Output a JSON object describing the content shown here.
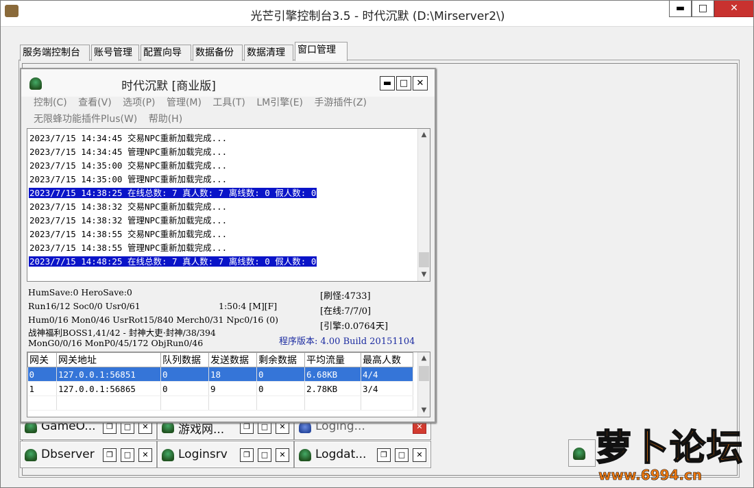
{
  "window": {
    "title": "光芒引擎控制台3.5 - 时代沉默 (D:\\Mirserver2\\)",
    "min": "▬",
    "max": "□",
    "close": "✕"
  },
  "tabs": [
    {
      "label": "服务端控制台",
      "active": false
    },
    {
      "label": "账号管理",
      "active": false
    },
    {
      "label": "配置向导",
      "active": false
    },
    {
      "label": "数据备份",
      "active": false
    },
    {
      "label": "数据清理",
      "active": false
    },
    {
      "label": "窗口管理",
      "active": true
    }
  ],
  "child": {
    "title": "时代沉默 [商业版]",
    "min": "▬",
    "max": "□",
    "close": "✕",
    "menu_row1": [
      "控制(C)",
      "查看(V)",
      "选项(P)",
      "管理(M)",
      "工具(T)",
      "LM引擎(E)",
      "手游插件(Z)"
    ],
    "menu_row2": [
      "无限蜂功能插件Plus(W)",
      "帮助(H)"
    ],
    "log": [
      {
        "text": "2023/7/15 14:34:45 交易NPC重新加载完成...",
        "highlight": false
      },
      {
        "text": "2023/7/15 14:34:45 管理NPC重新加载完成...",
        "highlight": false
      },
      {
        "text": "2023/7/15 14:35:00 交易NPC重新加载完成...",
        "highlight": false
      },
      {
        "text": "2023/7/15 14:35:00 管理NPC重新加载完成...",
        "highlight": false
      },
      {
        "text": "2023/7/15 14:38:25 在线总数: 7 真人数: 7 离线数: 0 假人数: 0",
        "highlight": true
      },
      {
        "text": "2023/7/15 14:38:32 交易NPC重新加载完成...",
        "highlight": false
      },
      {
        "text": "2023/7/15 14:38:32 管理NPC重新加载完成...",
        "highlight": false
      },
      {
        "text": "2023/7/15 14:38:55 交易NPC重新加载完成...",
        "highlight": false
      },
      {
        "text": "2023/7/15 14:38:55 管理NPC重新加载完成...",
        "highlight": false
      },
      {
        "text": "2023/7/15 14:48:25 在线总数: 7 真人数: 7 离线数: 0 假人数: 0",
        "highlight": true
      }
    ],
    "stats": {
      "line1": "HumSave:0 HeroSave:0",
      "line2": "Run16/12 Soc0/0 Usr0/61",
      "time": "1:50:4 [M][F]",
      "line3": "Hum0/16 Mon0/46 UsrRot15/840 Merch0/31 Npc0/16 (0)",
      "line4": "战神福利BOSS1,41/42 - 封神大吏·封神/38/394",
      "line5": "MonG0/0/16 MonP0/45/172 ObjRun0/46",
      "refresh": "[刷怪:4733]",
      "online": "[在线:7/7/0]",
      "engine": "[引擎:0.0764天]",
      "version": "程序版本: 4.00 Build 20151104"
    },
    "gateway": {
      "headers": [
        "网关",
        "网关地址",
        "队列数据",
        "发送数据",
        "剩余数据",
        "平均流量",
        "最高人数"
      ],
      "rows": [
        [
          "0",
          "127.0.0.1:56851",
          "0",
          "18",
          "0",
          "6.68KB",
          "4/4"
        ],
        [
          "1",
          "127.0.0.1:56865",
          "0",
          "9",
          "0",
          "2.78KB",
          "3/4"
        ]
      ]
    }
  },
  "minimized": [
    {
      "title": "GameO...",
      "inactive": false
    },
    {
      "title": "游戏网...",
      "inactive": false
    },
    {
      "title": "Loging...",
      "inactive": true
    },
    {
      "title": "Dbserver",
      "inactive": false
    },
    {
      "title": "Loginsrv",
      "inactive": false
    },
    {
      "title": "Logdat...",
      "inactive": false
    }
  ],
  "mini_buttons": {
    "restore": "❐",
    "max": "□",
    "close": "✕"
  },
  "watermark": {
    "logo": "萝卜论坛",
    "url": "www.6994.cn"
  }
}
